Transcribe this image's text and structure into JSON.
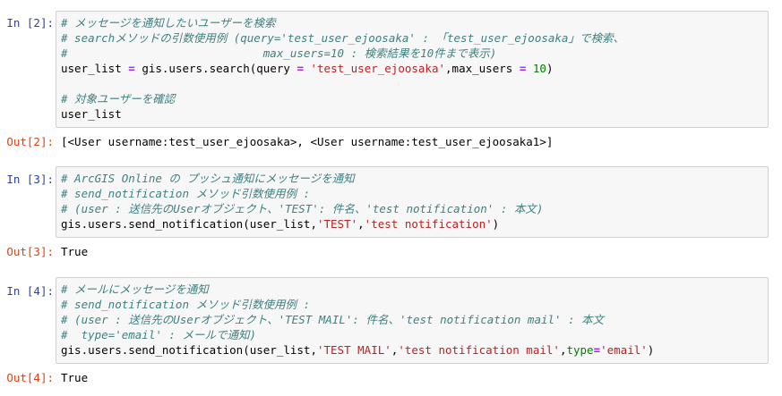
{
  "cells": [
    {
      "in_prompt": "In [2]:",
      "code": {
        "c1": "# メッセージを通知したいユーザーを検索",
        "c2": "# searchメソッドの引数使用例 (query='test_user_ejoosaka' : 「test_user_ejoosaka」で検索、",
        "c3": "#                             max_users=10 : 検索結果を10件まで表示)",
        "code_a": "user_list",
        "eq": "=",
        "code_b": "gis.users.search(query",
        "eq2": "=",
        "str1": "'test_user_ejoosaka'",
        "code_c": ",max_users",
        "eq3": "=",
        "num1": "10",
        "code_d": ")",
        "c4": "# 対象ユーザーを確認",
        "code_e": "user_list"
      },
      "out_prompt": "Out[2]:",
      "output": "[<User username:test_user_ejoosaka>, <User username:test_user_ejoosaka1>]"
    },
    {
      "in_prompt": "In [3]:",
      "code": {
        "c1": "# ArcGIS Online の プッシュ通知にメッセージを通知",
        "c2": "# send_notification メソッド引数使用例 :",
        "c3": "# (user : 送信先のUserオブジェクト、'TEST': 件名、'test notification' : 本文)",
        "code_a": "gis.users.send_notification(user_list,",
        "str1": "'TEST'",
        "code_b": ",",
        "str2": "'test notification'",
        "code_c": ")"
      },
      "out_prompt": "Out[3]:",
      "output": "True"
    },
    {
      "in_prompt": "In [4]:",
      "code": {
        "c1": "# メールにメッセージを通知",
        "c2": "# send_notification メソッド引数使用例 :",
        "c3": "# (user : 送信先のUserオブジェクト、'TEST MAIL': 件名、'test notification mail' : 本文",
        "c4": "#  type='email' : メールで通知)",
        "code_a": "gis.users.send_notification(user_list,",
        "str1": "'TEST MAIL'",
        "code_b": ",",
        "str2": "'test notification mail'",
        "code_c": ",",
        "kw1": "type",
        "eq": "=",
        "str3": "'email'",
        "code_d": ")"
      },
      "out_prompt": "Out[4]:",
      "output": "True"
    }
  ]
}
